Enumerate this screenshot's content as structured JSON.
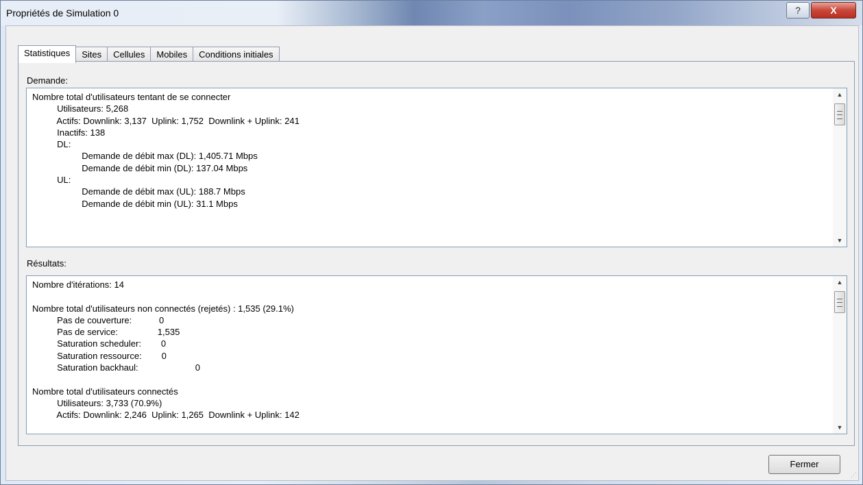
{
  "window": {
    "title": "Propriétés de Simulation 0",
    "help_label": "?",
    "close_label": "X"
  },
  "tabs": [
    {
      "label": "Statistiques",
      "active": true
    },
    {
      "label": "Sites",
      "active": false
    },
    {
      "label": "Cellules",
      "active": false
    },
    {
      "label": "Mobiles",
      "active": false
    },
    {
      "label": "Conditions initiales",
      "active": false
    }
  ],
  "demande": {
    "label": "Demande:",
    "lines": [
      "Nombre total d'utilisateurs tentant de se connecter",
      "          Utilisateurs: 5,268",
      "          Actifs: Downlink: 3,137  Uplink: 1,752  Downlink + Uplink: 241",
      "          Inactifs: 138",
      "          DL:",
      "                    Demande de débit max (DL): 1,405.71 Mbps",
      "                    Demande de débit min (DL): 137.04 Mbps",
      "          UL:",
      "                    Demande de débit max (UL): 188.7 Mbps",
      "                    Demande de débit min (UL): 31.1 Mbps"
    ]
  },
  "resultats": {
    "label": "Résultats:",
    "lines": [
      "Nombre d'itérations: 14",
      "",
      "Nombre total d'utilisateurs non connectés (rejetés) : 1,535 (29.1%)",
      "          Pas de couverture:           0",
      "          Pas de service:                1,535",
      "          Saturation scheduler:        0",
      "          Saturation ressource:        0",
      "          Saturation backhaul:                       0",
      "",
      "Nombre total d'utilisateurs connectés",
      "          Utilisateurs: 3,733 (70.9%)",
      "          Actifs: Downlink: 2,246  Uplink: 1,265  Downlink + Uplink: 142"
    ]
  },
  "buttons": {
    "close": "Fermer"
  },
  "icons": {
    "scroll_up": "▲",
    "scroll_down": "▼"
  }
}
